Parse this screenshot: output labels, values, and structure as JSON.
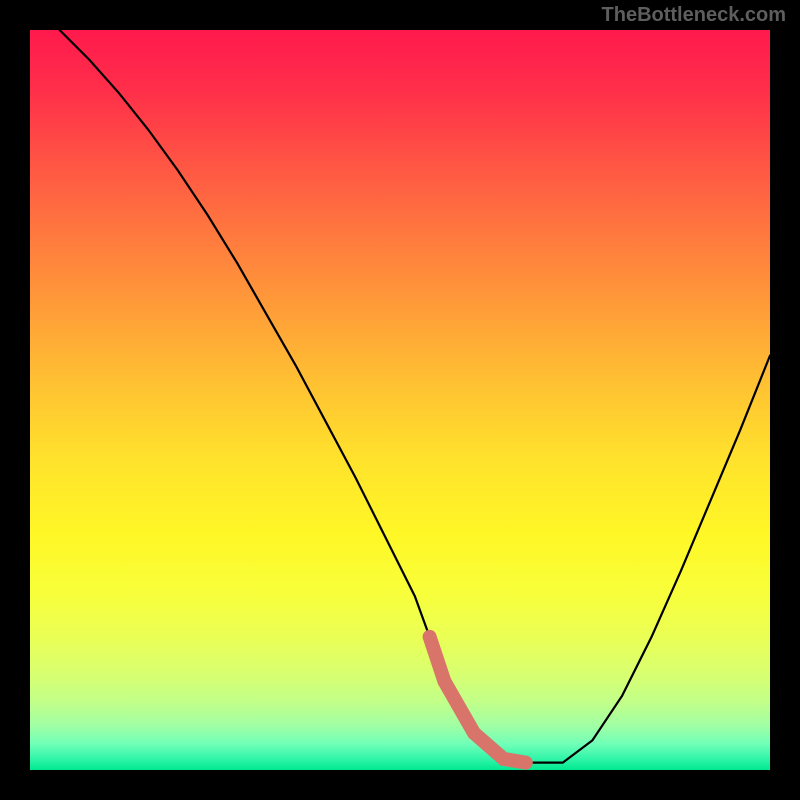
{
  "watermark": "TheBottleneck.com",
  "chart_data": {
    "type": "line",
    "title": "",
    "xlabel": "",
    "ylabel": "",
    "xlim": [
      0,
      100
    ],
    "ylim": [
      0,
      100
    ],
    "grid": false,
    "series": [
      {
        "name": "bottleneck-curve",
        "x": [
          4,
          8,
          12,
          16,
          20,
          24,
          28,
          32,
          36,
          40,
          44,
          48,
          52,
          54,
          56,
          60,
          64,
          67,
          72,
          76,
          80,
          84,
          88,
          92,
          96,
          100
        ],
        "values": [
          100,
          96,
          91.5,
          86.5,
          81,
          75,
          68.5,
          61.5,
          54.5,
          47,
          39.5,
          31.5,
          23.5,
          18,
          12,
          5,
          1.5,
          1,
          1,
          4,
          10,
          18,
          27,
          36.5,
          46,
          56
        ]
      }
    ],
    "annotations": [
      {
        "type": "highlight-segment",
        "x_range": [
          54,
          67
        ],
        "color": "#d9746b"
      }
    ],
    "background_gradient": {
      "top": "#ff1a4d",
      "mid": "#ffe22c",
      "bottom": "#00e890"
    }
  }
}
